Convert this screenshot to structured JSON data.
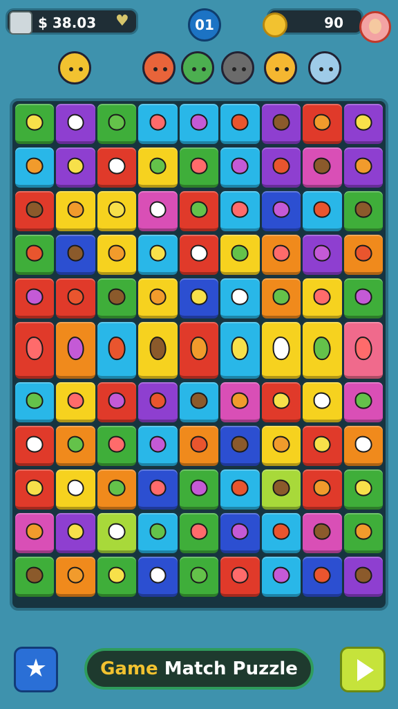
{
  "hud": {
    "money": "$ 38.03",
    "level": "01",
    "score": "90"
  },
  "title": {
    "part1": "Game",
    "part2": " Match Puzzle"
  },
  "icons": {
    "menu": "grid-icon",
    "heart": "heart-icon",
    "coin": "coin-icon",
    "avatar": "player-avatar-icon",
    "star": "star-icon",
    "play": "play-icon"
  },
  "characters": [
    {
      "name": "hat-character-icon",
      "color": "#f2c230"
    },
    {
      "name": "red-hair-character-icon",
      "color": "#e8643a"
    },
    {
      "name": "green-hair-character-icon",
      "color": "#4caf50"
    },
    {
      "name": "ninja-character-icon",
      "color": "#6b6b6b"
    },
    {
      "name": "yellow-hat-character-icon",
      "color": "#f5b731"
    },
    {
      "name": "blue-ball-character-icon",
      "color": "#9ecbe8"
    }
  ],
  "board": {
    "rows": [
      {
        "h": 58,
        "cols": 9,
        "colors": [
          "green",
          "purple",
          "green",
          "cyan",
          "cyan",
          "cyan",
          "purple",
          "red",
          "purple"
        ]
      },
      {
        "h": 58,
        "cols": 9,
        "colors": [
          "cyan",
          "purple",
          "red",
          "yellow",
          "green",
          "cyan",
          "purple",
          "magenta",
          "purple"
        ]
      },
      {
        "h": 58,
        "cols": 9,
        "colors": [
          "red",
          "yellow",
          "yellow",
          "magenta",
          "red",
          "cyan",
          "blue",
          "cyan",
          "green"
        ]
      },
      {
        "h": 58,
        "cols": 9,
        "colors": [
          "green",
          "blue",
          "yellow",
          "cyan",
          "red",
          "yellow",
          "orange",
          "purple",
          "orange"
        ]
      },
      {
        "h": 58,
        "cols": 9,
        "colors": [
          "red",
          "red",
          "green",
          "yellow",
          "blue",
          "cyan",
          "orange",
          "yellow",
          "green"
        ]
      },
      {
        "h": 82,
        "cols": 9,
        "colors": [
          "red",
          "orange",
          "cyan",
          "yellow",
          "red",
          "cyan",
          "yellow",
          "yellow",
          "pink"
        ]
      },
      {
        "h": 58,
        "cols": 9,
        "colors": [
          "cyan",
          "yellow",
          "red",
          "purple",
          "cyan",
          "magenta",
          "red",
          "yellow",
          "magenta"
        ]
      },
      {
        "h": 58,
        "cols": 9,
        "colors": [
          "red",
          "orange",
          "green",
          "cyan",
          "orange",
          "blue",
          "yellow",
          "red",
          "orange"
        ]
      },
      {
        "h": 58,
        "cols": 9,
        "colors": [
          "red",
          "yellow",
          "orange",
          "blue",
          "green",
          "cyan",
          "lime",
          "red",
          "green"
        ]
      },
      {
        "h": 58,
        "cols": 9,
        "colors": [
          "magenta",
          "purple",
          "lime",
          "cyan",
          "green",
          "blue",
          "cyan",
          "magenta",
          "green"
        ]
      },
      {
        "h": 58,
        "cols": 9,
        "colors": [
          "green",
          "orange",
          "green",
          "blue",
          "green",
          "red",
          "cyan",
          "blue",
          "purple"
        ]
      }
    ],
    "palette": {
      "green": "#3fae3a",
      "purple": "#8e3fd0",
      "cyan": "#29b7e8",
      "red": "#e03a2a",
      "yellow": "#f6d21f",
      "magenta": "#d94fb6",
      "blue": "#2c4fd1",
      "orange": "#f08a1c",
      "pink": "#f06a8c",
      "lime": "#a8d93a"
    }
  }
}
